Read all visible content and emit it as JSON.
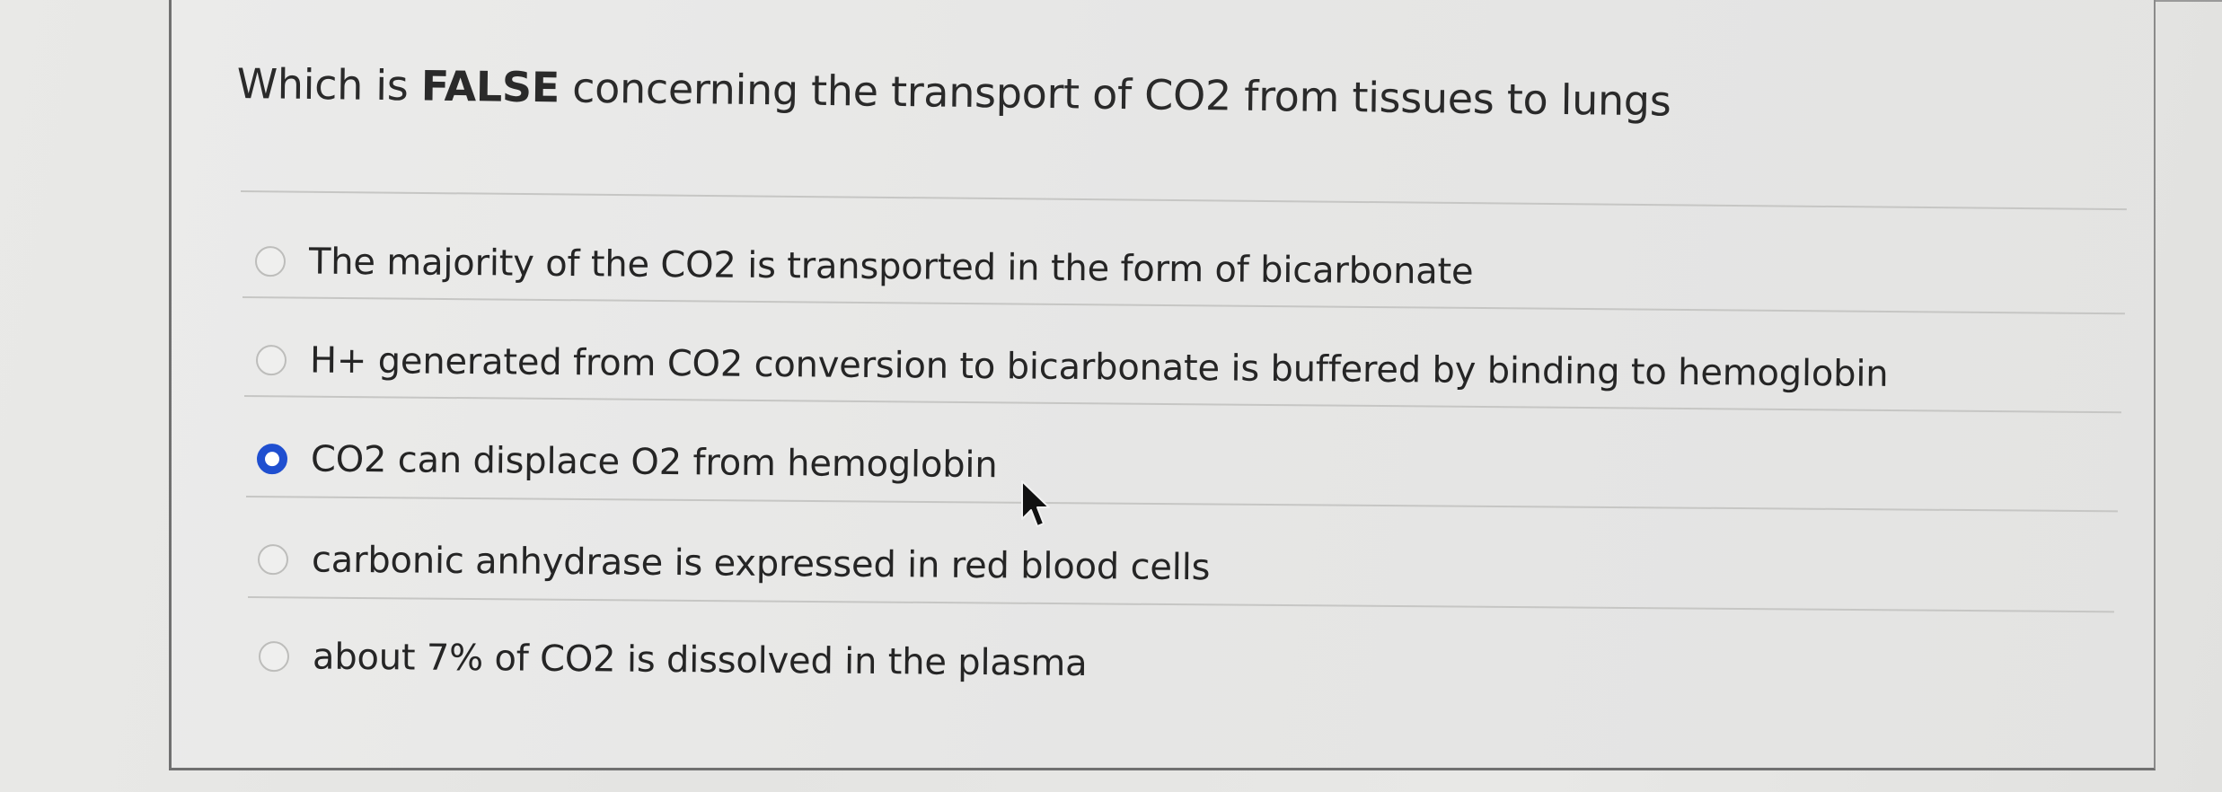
{
  "question": {
    "prefix": "Which is ",
    "emphasis": "FALSE",
    "suffix": " concerning the transport of CO2 from tissues to lungs"
  },
  "options": [
    {
      "label": "The majority of the CO2 is transported in the form of bicarbonate",
      "selected": false
    },
    {
      "label": "H+ generated from CO2 conversion to bicarbonate is buffered by binding to hemoglobin",
      "selected": false
    },
    {
      "label": "CO2 can displace O2 from hemoglobin",
      "selected": true
    },
    {
      "label": "carbonic anhydrase is expressed in red blood cells",
      "selected": false
    },
    {
      "label": "about 7% of CO2 is dissolved in the plasma",
      "selected": false
    }
  ],
  "colors": {
    "accent": "#1f4fd0",
    "text": "#252525"
  },
  "icons": {
    "cursor": "mouse-pointer-icon"
  }
}
